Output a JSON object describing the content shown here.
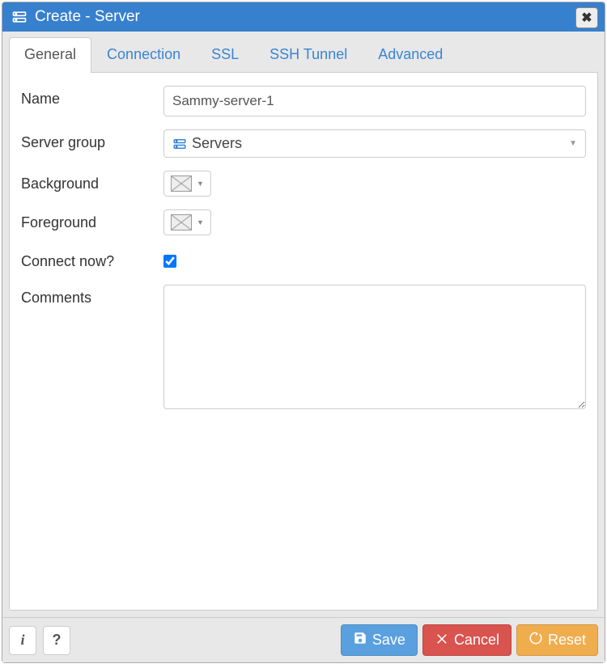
{
  "header": {
    "title": "Create - Server",
    "icon": "server-icon",
    "close_icon": "close-icon"
  },
  "tabs": [
    {
      "label": "General",
      "active": true
    },
    {
      "label": "Connection",
      "active": false
    },
    {
      "label": "SSL",
      "active": false
    },
    {
      "label": "SSH Tunnel",
      "active": false
    },
    {
      "label": "Advanced",
      "active": false
    }
  ],
  "form": {
    "name_label": "Name",
    "name_value": "Sammy-server-1",
    "server_group_label": "Server group",
    "server_group_value": "Servers",
    "background_label": "Background",
    "background_value": "none",
    "foreground_label": "Foreground",
    "foreground_value": "none",
    "connect_now_label": "Connect now?",
    "connect_now_checked": true,
    "comments_label": "Comments",
    "comments_value": ""
  },
  "footer": {
    "info_icon": "info-icon",
    "help_icon": "help-icon",
    "save_label": "Save",
    "cancel_label": "Cancel",
    "reset_label": "Reset"
  }
}
